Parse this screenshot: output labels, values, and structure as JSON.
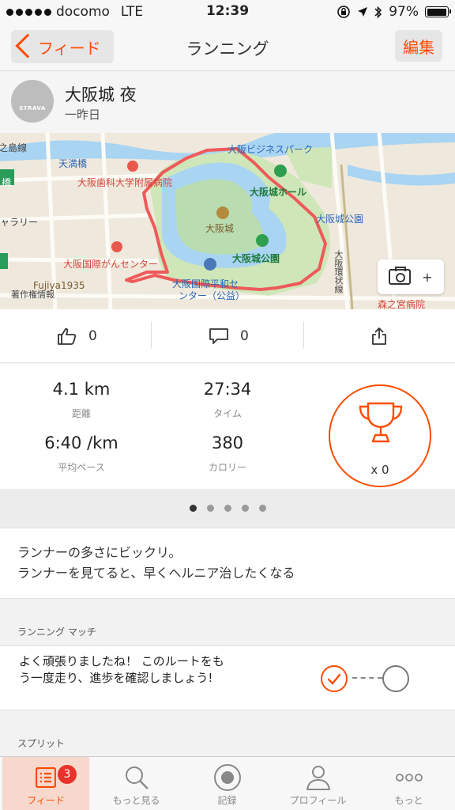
{
  "status_bar": {
    "carrier": "docomo",
    "network": "LTE",
    "time": "12:39",
    "battery": "97%",
    "battery_level": 0.97
  },
  "nav": {
    "back_label": "フィード",
    "title": "ランニング",
    "edit_label": "編集"
  },
  "activity": {
    "avatar_text": "STRAVA",
    "title": "大阪城 夜",
    "date": "一昨日"
  },
  "map": {
    "labels": {
      "tenmabashi": "天満橋",
      "hashi": "橋",
      "dental_hospital": "大阪歯科大学附属病院",
      "business_park": "大阪ビジネスパーク",
      "castle_hall": "大阪城ホール",
      "castle": "大阪城",
      "castle_park": "大阪城公園",
      "castle_park_station": "大阪城公園",
      "gallery": "ャラリー",
      "cancer_center": "大阪国際がんセンター",
      "peace_center": "大阪国際平和セ",
      "peace_center2": "ンター（公益）",
      "fujiya": "Fujiya1935",
      "copyright": "著作権情報",
      "loop_line": "大阪環状線",
      "morinomiya": "森之宮病院",
      "line_top": "之島線"
    },
    "camera_plus": "+"
  },
  "social": {
    "kudos": "0",
    "comments": "0"
  },
  "stats": {
    "distance": "4.1 km",
    "distance_label": "距離",
    "time": "27:34",
    "time_label": "タイム",
    "pace": "6:40 /km",
    "pace_label": "平均ペース",
    "calories": "380",
    "calories_label": "カロリー",
    "trophies": "x 0"
  },
  "pager": {
    "count": 5,
    "active": 0
  },
  "description": {
    "line1": "ランナーの多さにビックリ。",
    "line2": "ランナーを見てると、早くヘルニア治したくなる"
  },
  "match": {
    "section": "ランニング マッチ",
    "text": "よく頑張りましたね！ このルートをもう一度走り、進歩を確認しましょう!"
  },
  "splits": {
    "section": "スプリット"
  },
  "tabbar": {
    "feed": "フィード",
    "feed_badge": "3",
    "explore": "もっと見る",
    "record": "記録",
    "profile": "プロフィール",
    "more": "もっと"
  },
  "colors": {
    "accent": "#fc4c02",
    "badge": "#e8322b"
  }
}
